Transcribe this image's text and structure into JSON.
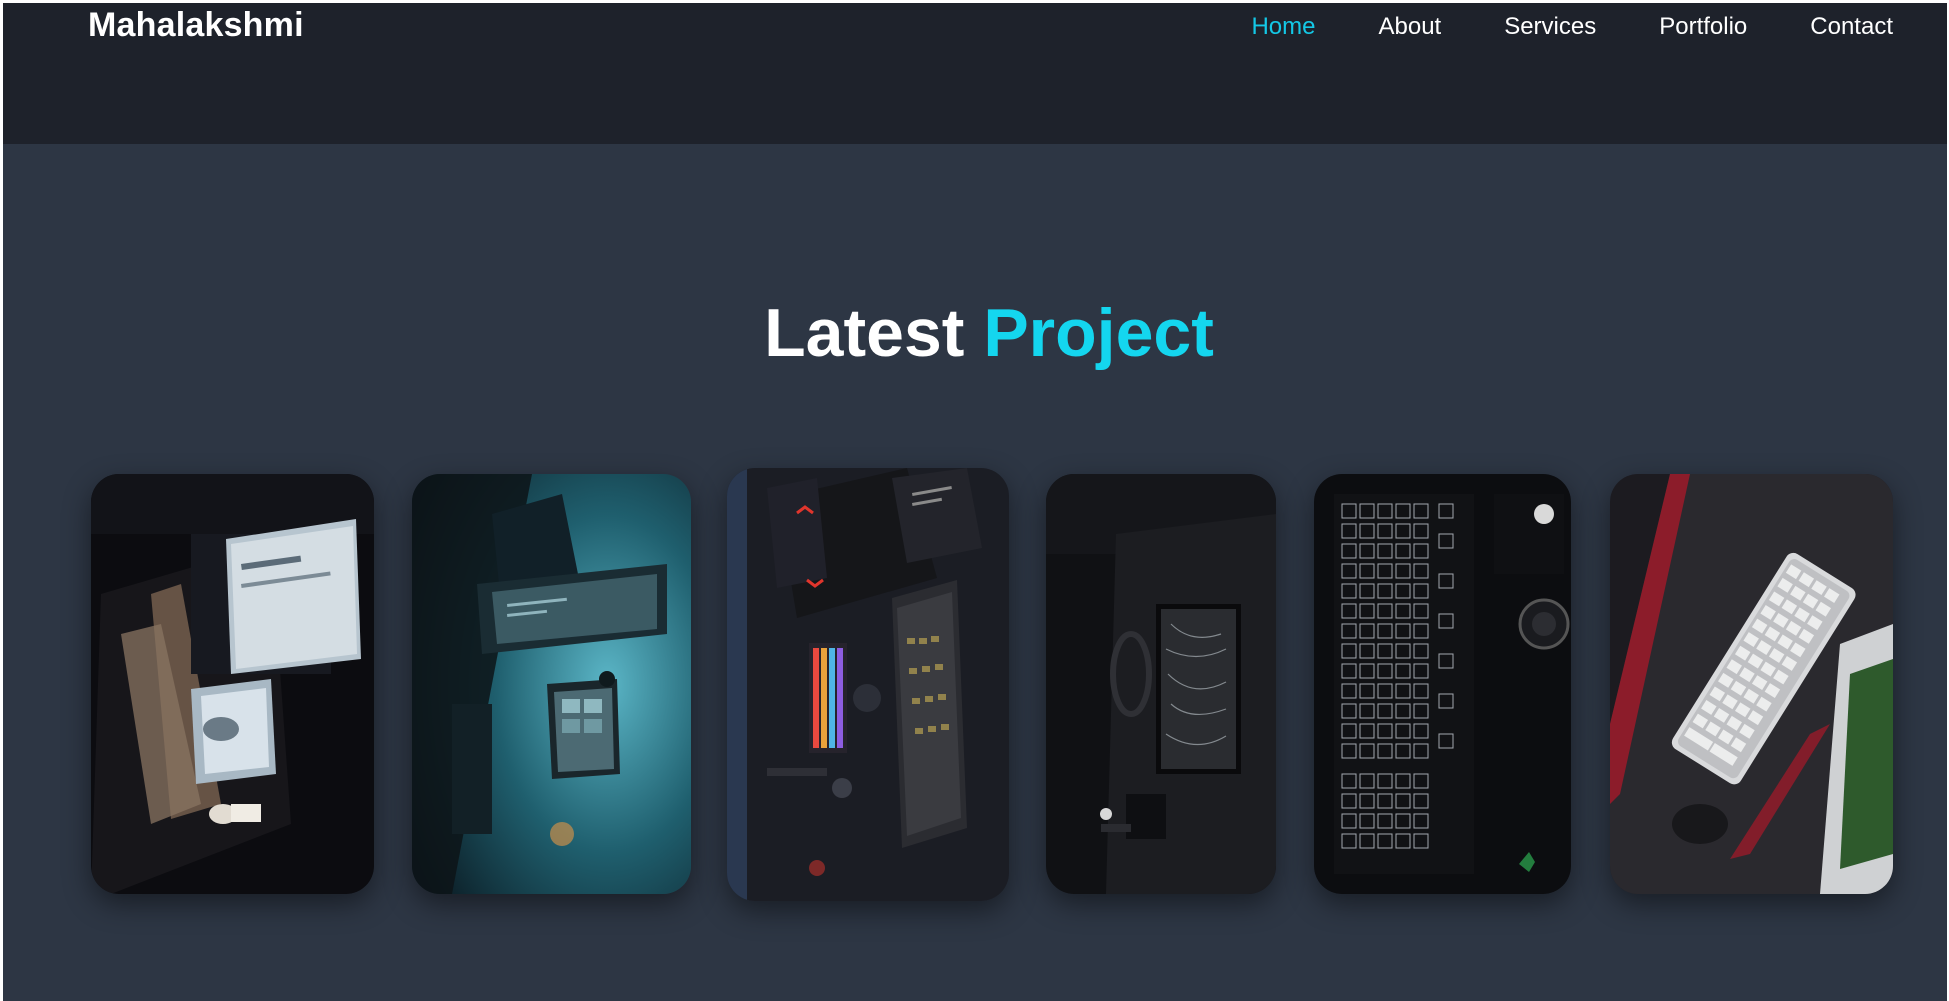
{
  "header": {
    "logo": "Mahalakshmi",
    "nav": [
      {
        "label": "Home",
        "active": true
      },
      {
        "label": "About",
        "active": false
      },
      {
        "label": "Services",
        "active": false
      },
      {
        "label": "Portfolio",
        "active": false
      },
      {
        "label": "Contact",
        "active": false
      }
    ]
  },
  "section": {
    "title_main": "Latest",
    "title_accent": "Project"
  },
  "colors": {
    "header_bg": "#1e222b",
    "page_bg": "#2d3644",
    "accent": "#14d6ef"
  },
  "projects": [
    {
      "image": "desk-setup-dark-monitors"
    },
    {
      "image": "teal-lit-desk-monitors"
    },
    {
      "image": "rgb-keyboard-mouse-mousepad"
    },
    {
      "image": "dark-desk-laptop"
    },
    {
      "image": "black-keyboard-closeup"
    },
    {
      "image": "white-keyboard-red-desk"
    }
  ]
}
